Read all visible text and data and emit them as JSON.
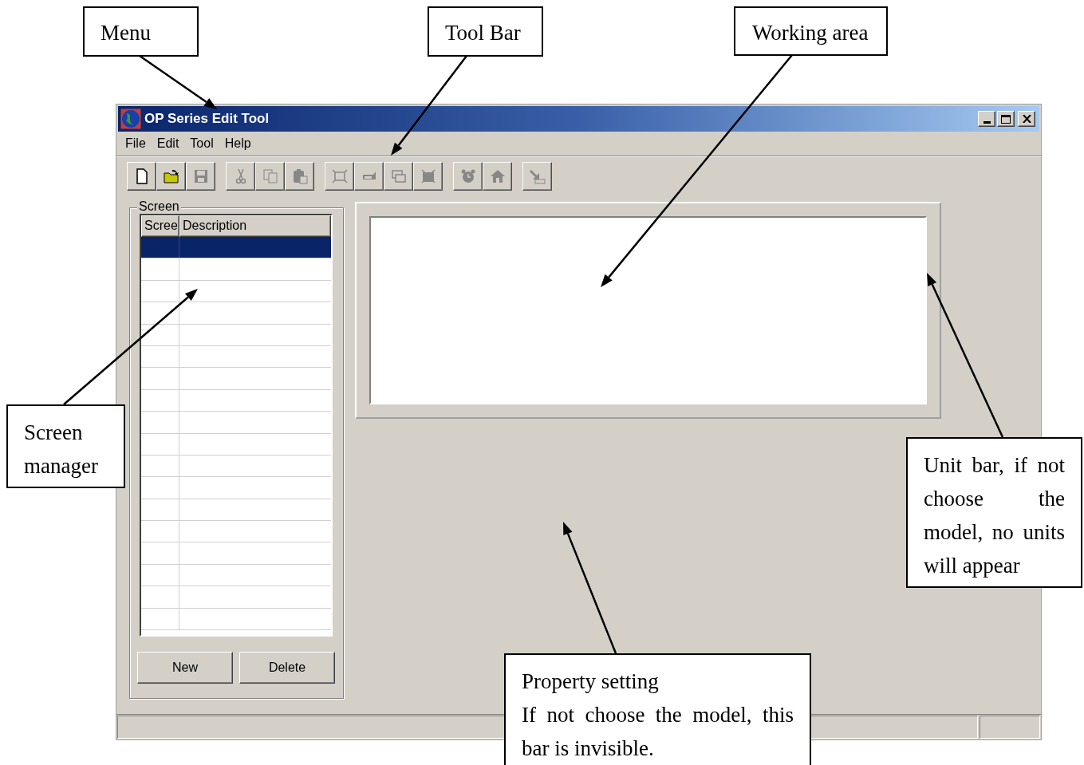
{
  "window": {
    "title": "OP Series Edit Tool"
  },
  "menu": [
    "File",
    "Edit",
    "Tool",
    "Help"
  ],
  "toolbar": {
    "groups": [
      {
        "buttons": [
          {
            "disabled": false
          },
          {
            "disabled": false
          },
          {
            "disabled": true
          }
        ]
      },
      {
        "buttons": [
          {
            "disabled": true
          },
          {
            "disabled": true
          },
          {
            "disabled": true
          }
        ]
      },
      {
        "buttons": [
          {
            "disabled": true
          },
          {
            "disabled": true
          },
          {
            "disabled": true
          },
          {
            "disabled": true
          }
        ]
      },
      {
        "buttons": [
          {
            "disabled": true
          },
          {
            "disabled": true
          }
        ]
      },
      {
        "buttons": [
          {
            "disabled": true
          }
        ]
      }
    ]
  },
  "screen_panel": {
    "title": "Screen",
    "columns": [
      "Scree",
      "Description"
    ],
    "rows": [
      {
        "selected": true
      },
      {
        "selected": false
      },
      {
        "selected": false
      },
      {
        "selected": false
      },
      {
        "selected": false
      },
      {
        "selected": false
      },
      {
        "selected": false
      },
      {
        "selected": false
      },
      {
        "selected": false
      },
      {
        "selected": false
      },
      {
        "selected": false
      },
      {
        "selected": false
      },
      {
        "selected": false
      },
      {
        "selected": false
      },
      {
        "selected": false
      },
      {
        "selected": false
      },
      {
        "selected": false
      },
      {
        "selected": false
      }
    ],
    "buttons": [
      "New",
      "Delete"
    ]
  },
  "callouts": [
    {
      "paragraphs": [
        "Menu"
      ]
    },
    {
      "paragraphs": [
        "Tool Bar"
      ]
    },
    {
      "paragraphs": [
        "Working area"
      ]
    },
    {
      "paragraphs": [
        "Screen manager"
      ]
    },
    {
      "paragraphs": [
        "Unit bar, if not choose the model, no units will appear"
      ]
    },
    {
      "paragraphs": [
        "Property setting",
        "If not choose the model, this bar is invisible."
      ]
    }
  ]
}
